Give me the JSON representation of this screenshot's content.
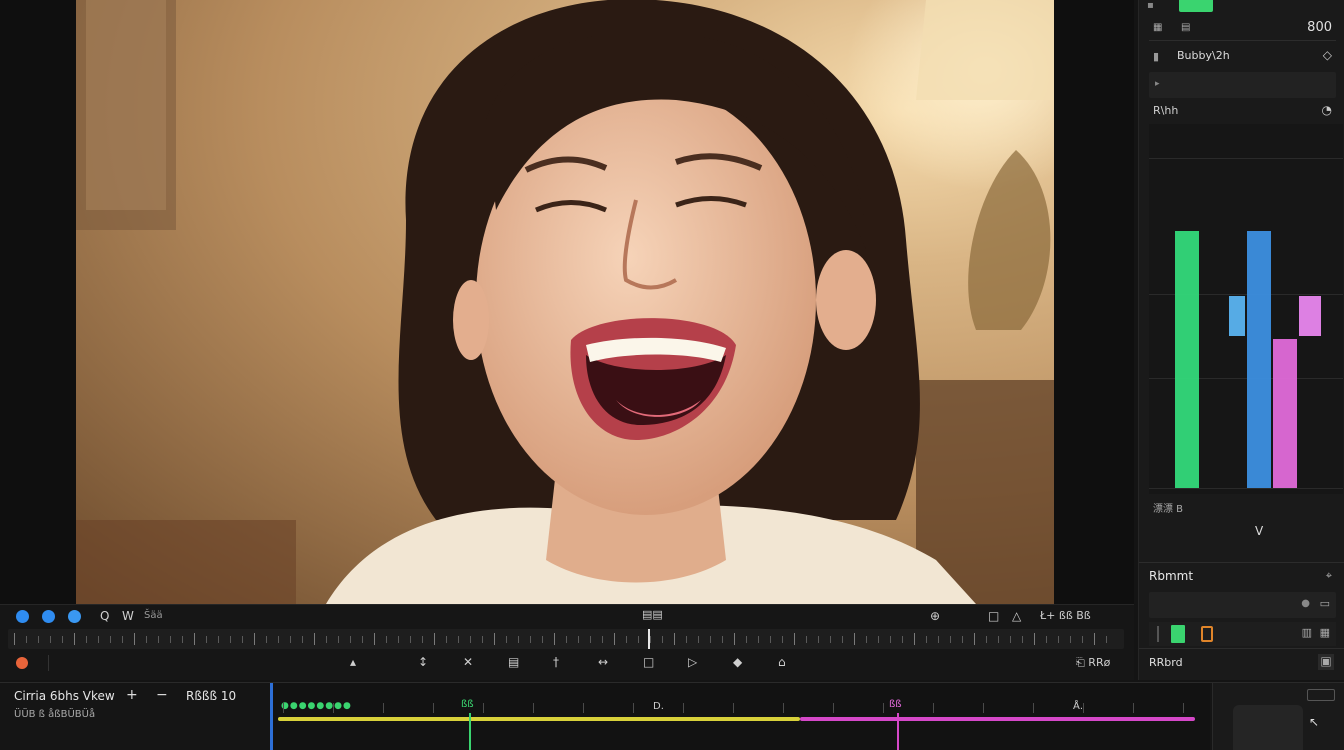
{
  "right_panel": {
    "top_value": "800",
    "layer_name": "Bubby\\2h",
    "scopes_label": "R\\hh",
    "bottom_label": "漂漂 B",
    "chevron": "V",
    "section2_title": "Rbmmt",
    "section3_title": "RRbrd",
    "mini_btn": "▣",
    "scope_bars": [
      {
        "color": "#33d97a",
        "level": 0.78
      },
      {
        "color": "#3c8fe0",
        "level": 0.78
      },
      {
        "color": "#e06ad9",
        "level": 0.45
      },
      {
        "color": "#5ab3f0",
        "level": 0.12
      },
      {
        "color": "#e886ee",
        "level": 0.12
      }
    ]
  },
  "transport": {
    "left_icons": [
      "comment-icon",
      "cloud-icon",
      "info-icon"
    ],
    "left_labels": [
      "Q",
      "W",
      "Šää"
    ],
    "center_label": "▤▤",
    "right_labels": [
      "⊕",
      "□",
      "△",
      "Ł+ ßß Bß"
    ],
    "bottom_right": "⎗ RRø",
    "tools": [
      "↕",
      "✕",
      "▤",
      "†",
      "↔",
      "□",
      "▷",
      "◆",
      "⌂"
    ]
  },
  "timeline": {
    "track_name": "Cirria 6bhs Vkew",
    "track_sub": "ÜÜB ß åßBÜBÜå",
    "timecode": "Rßßß 10",
    "marker_green": "ßß",
    "marker_pink": "ßß",
    "mid_label": "D.",
    "end_label": "Å."
  },
  "colors": {
    "accent_blue": "#2d6fd6",
    "green": "#3ad46f",
    "yellow": "#d8d13a",
    "pink": "#d548c8"
  }
}
